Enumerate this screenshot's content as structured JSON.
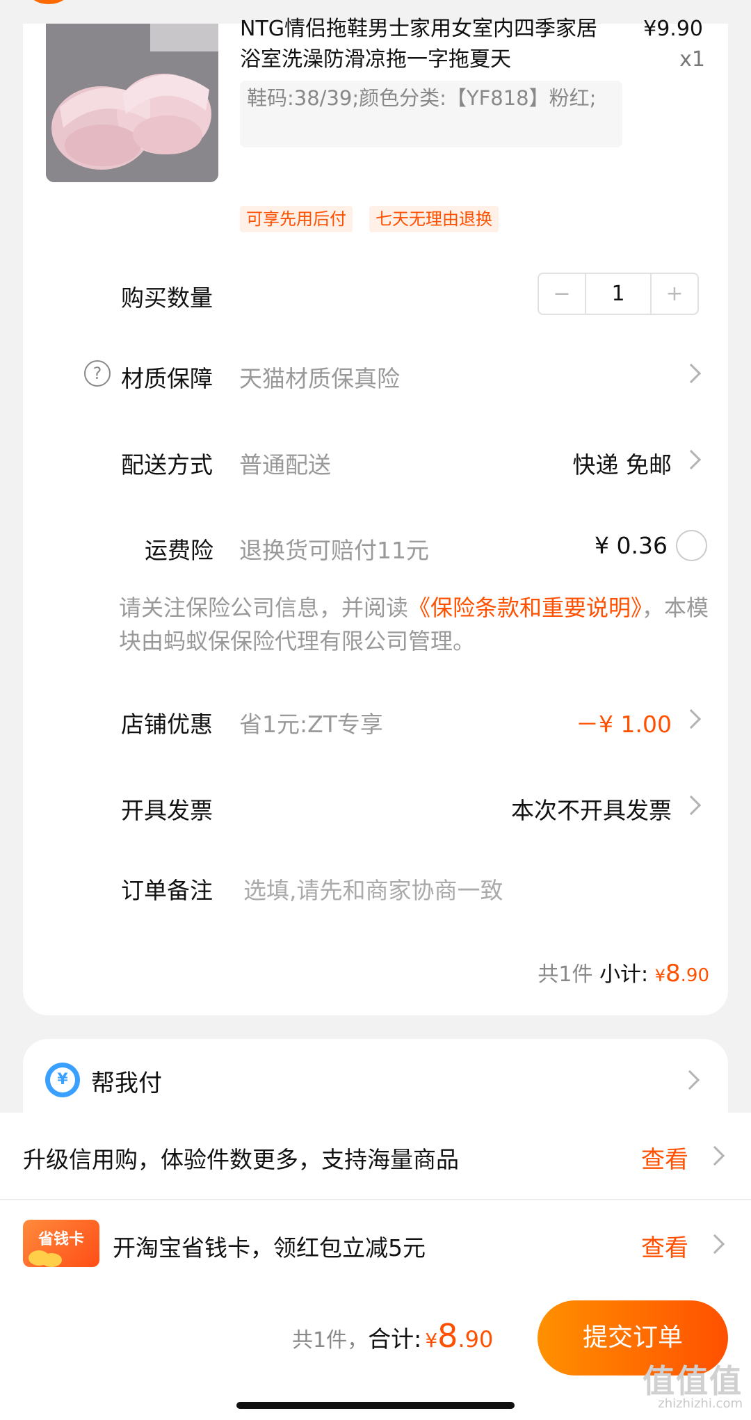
{
  "product": {
    "title": "NTG情侣拖鞋男士家用女室内四季家居浴室洗澡防滑凉拖一字拖夏天",
    "price": "¥9.90",
    "quantity": "x1",
    "sku": "鞋码:38/39;颜色分类:【YF818】粉红;",
    "tags": [
      "可享先用后付",
      "七天无理由退换"
    ]
  },
  "rows": {
    "quantity": {
      "label": "购买数量",
      "minus": "−",
      "value": "1",
      "plus": "+"
    },
    "material": {
      "label": "材质保障",
      "value": "天猫材质保真险"
    },
    "delivery": {
      "label": "配送方式",
      "value": "普通配送",
      "right": "快递 免邮"
    },
    "insurance": {
      "label": "运费险",
      "value": "退换货可赔付11元",
      "right": "¥ 0.36"
    },
    "notice": {
      "pre": "请关注保险公司信息，并阅读",
      "link": "《保险条款和重要说明》",
      "post": "，本模块由蚂蚁保保险代理有限公司管理。"
    },
    "coupon": {
      "label": "店铺优惠",
      "value": "省1元:ZT专享",
      "right": "－¥ 1.00"
    },
    "invoice": {
      "label": "开具发票",
      "right": "本次不开具发票"
    },
    "remark": {
      "label": "订单备注",
      "placeholder": "选填,请先和商家协商一致"
    }
  },
  "subtotal": {
    "count": "共1件",
    "label": "小计:",
    "currency": "¥",
    "int": "8",
    "dec": ".90"
  },
  "pay_for_me": {
    "icon": "yuan-icon",
    "label": "帮我付"
  },
  "promos": [
    {
      "text": "升级信用购，体验件数更多，支持海量商品",
      "action": "查看"
    },
    {
      "logo": "省钱卡",
      "text": "开淘宝省钱卡，领红包立减5元",
      "action": "查看"
    }
  ],
  "footer": {
    "count": "共1件，",
    "total_label": "合计:",
    "currency": "¥",
    "total_int": "8",
    "total_dec": ".90",
    "submit": "提交订单"
  },
  "watermark": {
    "main": "值值值",
    "sub": "zhizhizhi.com"
  },
  "colors": {
    "accent": "#ff5000",
    "pay_icon": "#3aa0ff"
  }
}
